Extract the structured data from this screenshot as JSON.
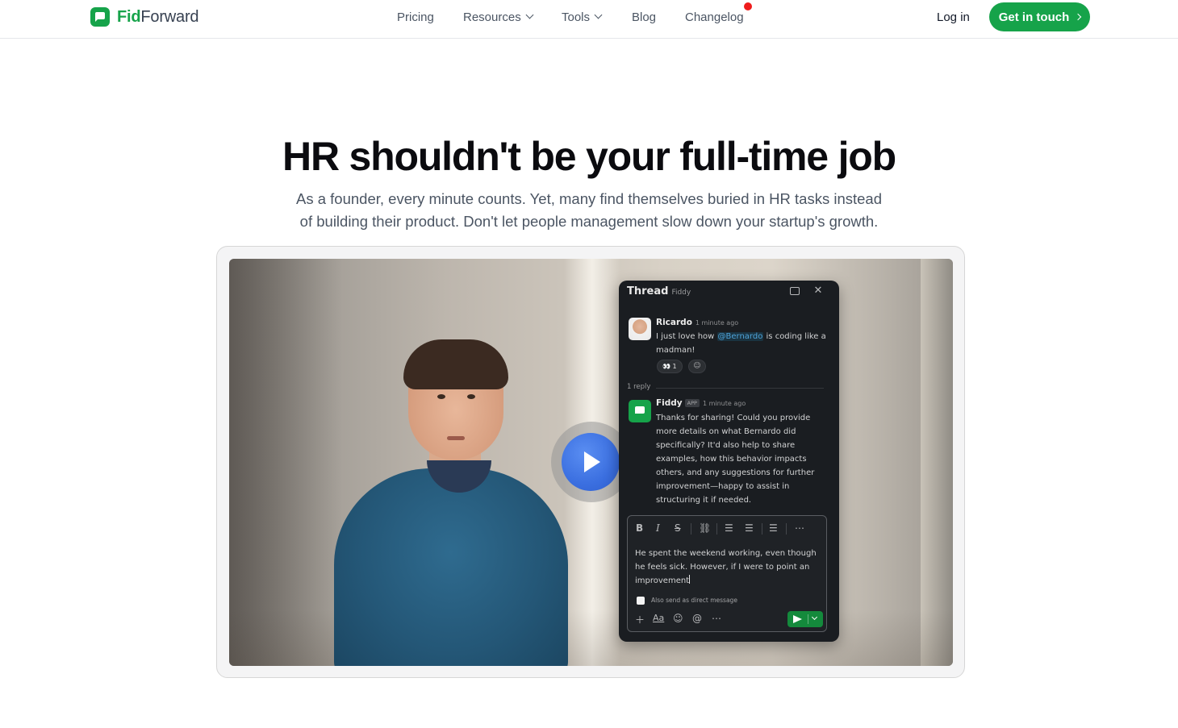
{
  "brand": {
    "name_bold": "Fid",
    "name_rest": "Forward",
    "accent": "#16a34a"
  },
  "nav": {
    "items": [
      {
        "label": "Pricing",
        "dropdown": false
      },
      {
        "label": "Resources",
        "dropdown": true
      },
      {
        "label": "Tools",
        "dropdown": true
      },
      {
        "label": "Blog",
        "dropdown": false
      },
      {
        "label": "Changelog",
        "dropdown": false,
        "notification": true
      }
    ],
    "login_label": "Log in",
    "cta_label": "Get in touch"
  },
  "hero": {
    "title": "HR shouldn't be your full-time job",
    "subtitle_line1": "As a founder, every minute counts. Yet, many find themselves buried in HR tasks instead",
    "subtitle_line2": "of building their product. Don't let people management slow down your startup's growth."
  },
  "video": {
    "play_icon": "play-icon",
    "thread": {
      "title": "Thread",
      "subtitle": "Fiddy",
      "message1": {
        "author": "Ricardo",
        "time": "1 minute ago",
        "text_before": "I just love how ",
        "mention": "@Bernardo",
        "text_after": " is coding like a madman!",
        "reaction": "👀 1"
      },
      "reply_count": "1 reply",
      "message2": {
        "author": "Fiddy",
        "badge": "APP",
        "time": "1 minute ago",
        "text": "Thanks for sharing! Could you provide more details on what Bernardo did specifically? It'd also help to share examples, how this behavior impacts others, and any suggestions for further improvement—happy to assist in structuring it if needed."
      },
      "composer": {
        "text": "He spent the weekend working, even though he feels sick. However, if I were to point an improvement",
        "dm_label": "Also send as direct message",
        "format_tools": [
          "B",
          "I",
          "S",
          "link",
          "ordered-list",
          "bullet-list",
          "block-quote",
          "more"
        ],
        "aa_label": "Aa"
      }
    }
  }
}
